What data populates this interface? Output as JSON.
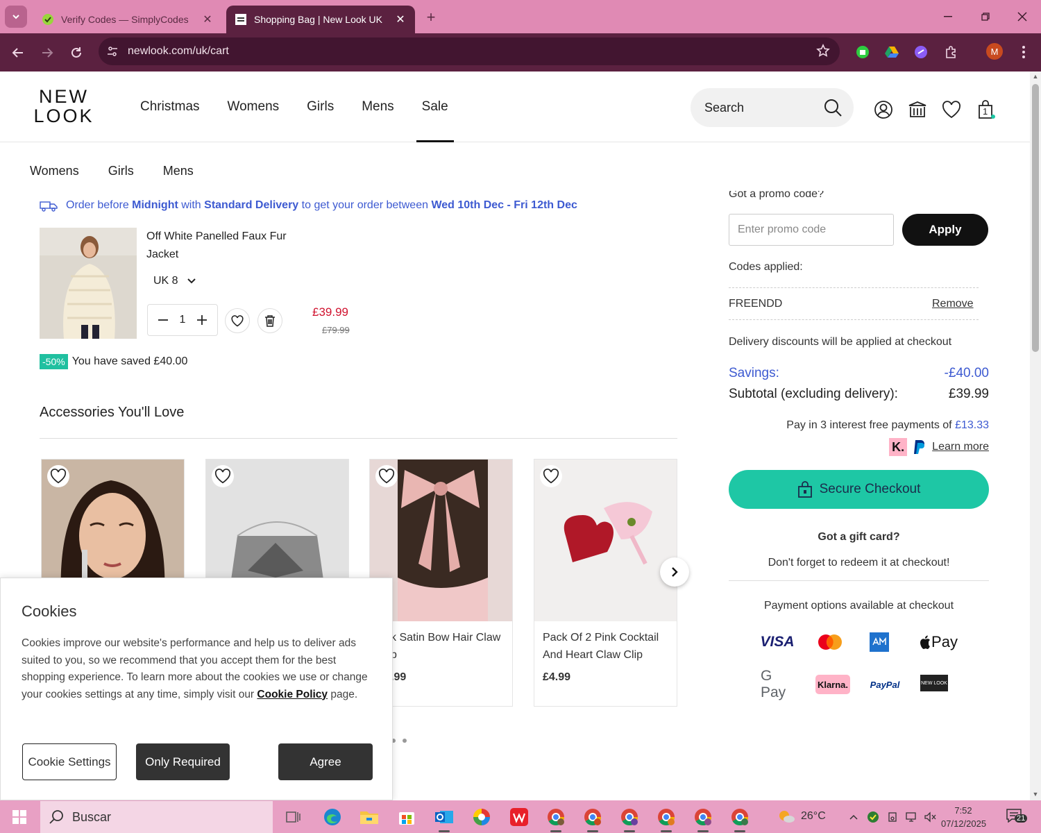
{
  "browser": {
    "tabs": [
      {
        "title": "Verify Codes — SimplyCodes",
        "active": false
      },
      {
        "title": "Shopping Bag | New Look UK",
        "active": true
      }
    ],
    "url": "newlook.com/uk/cart",
    "profile_initial": "M"
  },
  "header": {
    "logo_line1": "NEW",
    "logo_line2": "LOOK",
    "nav": [
      "Christmas",
      "Womens",
      "Girls",
      "Mens",
      "Sale"
    ],
    "active_nav": "Sale",
    "search_placeholder": "Search",
    "bag_count": "1"
  },
  "sub_nav": [
    "Womens",
    "Girls",
    "Mens"
  ],
  "delivery_banner": {
    "p1": "Order before ",
    "b1": "Midnight",
    "p2": " with ",
    "b2": "Standard Delivery",
    "p3": " to get your order between ",
    "b3": "Wed 10th Dec - Fri 12th Dec"
  },
  "cart_item": {
    "name": "Off White Panelled Faux Fur Jacket",
    "size": "UK 8",
    "quantity": "1",
    "price": "£39.99",
    "was_price": "£79.99",
    "discount_badge": "-50%",
    "saved_text": "You have saved £40.00"
  },
  "accessories": {
    "title": "Accessories You'll Love",
    "items": [
      {
        "name": "",
        "price": ""
      },
      {
        "name": "",
        "price": ""
      },
      {
        "name": "k Satin Bow Hair Claw\np",
        "price": ".99"
      },
      {
        "name": "Pack Of 2 Pink Cocktail And Heart Claw Clip",
        "price": "£4.99"
      }
    ]
  },
  "summary": {
    "promo_heading": "Got a promo code?",
    "promo_placeholder": "Enter promo code",
    "apply_label": "Apply",
    "codes_applied_label": "Codes applied:",
    "code": "FREENDD",
    "remove_label": "Remove",
    "delivery_note": "Delivery discounts will be applied at checkout",
    "savings_label": "Savings:",
    "savings_value": "-£40.00",
    "subtotal_label": "Subtotal (excluding delivery):",
    "subtotal_value": "£39.99",
    "pay3_text": "Pay in 3 interest free payments of ",
    "pay3_amount": "£13.33",
    "klarna_k": "K.",
    "learn_more": "Learn more",
    "checkout_label": "Secure Checkout",
    "gift_title": "Got a gift card?",
    "gift_note": "Don't forget to redeem it at checkout!",
    "payment_title": "Payment options available at checkout",
    "payment_logos": [
      "VISA",
      "Pay",
      "G Pay",
      "Klarna.",
      "PayPal",
      "NEW LOOK"
    ]
  },
  "cookie": {
    "title": "Cookies",
    "body": "Cookies improve our website's performance and help us to deliver ads suited to you, so we recommend that you accept them for the best shopping experience. To learn more about the cookies we use or change your cookies settings at any time, simply visit our ",
    "link": "Cookie Policy",
    "body_end": " page.",
    "settings_label": "Cookie Settings",
    "required_label": "Only Required",
    "agree_label": "Agree"
  },
  "taskbar": {
    "search_placeholder": "Buscar",
    "temperature": "26°C",
    "time": "7:52",
    "date": "07/12/2025",
    "notifications": "21"
  },
  "colors": {
    "tabbar": "#e08ab4",
    "toolbar": "#5b2140",
    "accent_blue": "#3d5ad1",
    "sale_red": "#d0122e",
    "checkout_green": "#1ec7a5",
    "taskbar": "#e8a0c4"
  }
}
